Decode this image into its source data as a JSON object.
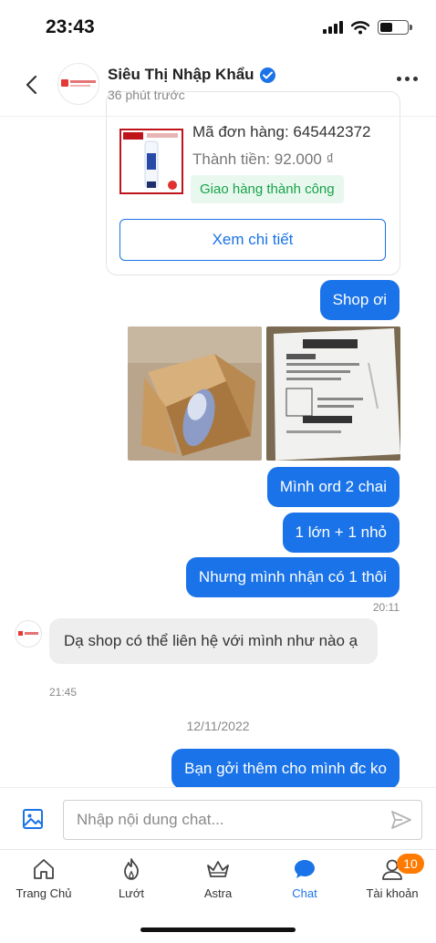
{
  "status_bar": {
    "time": "23:43"
  },
  "header": {
    "shop_name": "Siêu Thị Nhập Khẩu",
    "last_seen": "36 phút trước"
  },
  "order_card": {
    "order_id": "Mã đơn hàng: 645442372",
    "total": "Thành tiền: 92.000 ₫",
    "status": "Giao hàng thành công",
    "detail_button": "Xem chi tiết"
  },
  "messages": {
    "m1": "Shop ơi",
    "m2": "Mình ord 2 chai",
    "m3": "1 lớn + 1 nhỏ",
    "m4": "Nhưng mình nhận có 1 thôi",
    "t1": "20:11",
    "reply": "Dạ shop có thể liên hệ với mình như nào ạ",
    "t2": "21:45",
    "date_separator": "12/11/2022",
    "m5": "Bạn gởi thêm cho mình đc ko"
  },
  "input": {
    "placeholder": "Nhập nội dung chat..."
  },
  "nav": {
    "home": "Trang Chủ",
    "feed": "Lướt",
    "astra": "Astra",
    "chat": "Chat",
    "account": "Tài khoản",
    "account_badge": "10"
  },
  "colors": {
    "accent": "#1a73e8",
    "badge": "#ff7a00",
    "success": "#16a34a"
  }
}
